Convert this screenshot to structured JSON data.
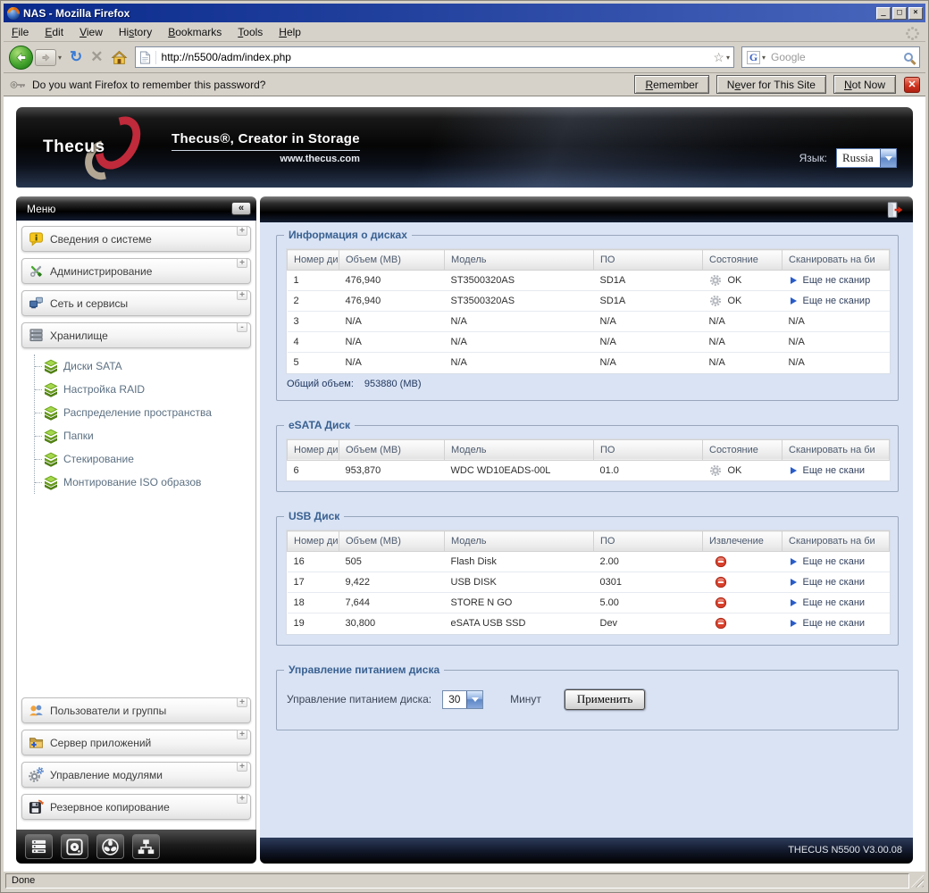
{
  "window": {
    "title": "NAS - Mozilla Firefox"
  },
  "menubar": {
    "items": [
      {
        "label": "File",
        "accel": 0
      },
      {
        "label": "Edit",
        "accel": 0
      },
      {
        "label": "View",
        "accel": 0
      },
      {
        "label": "History",
        "accel": 2
      },
      {
        "label": "Bookmarks",
        "accel": 0
      },
      {
        "label": "Tools",
        "accel": 0
      },
      {
        "label": "Help",
        "accel": 0
      }
    ]
  },
  "toolbar": {
    "url": "http://n5500/adm/index.php",
    "search_engine": "Google"
  },
  "notification": {
    "message": "Do you want Firefox to remember this password?",
    "buttons": [
      {
        "label": "Remember",
        "accel": 0
      },
      {
        "label": "Never for This Site",
        "accel": 1
      },
      {
        "label": "Not Now",
        "accel": 0
      }
    ]
  },
  "banner": {
    "brand": "Thecus",
    "tagline": "Thecus®, Creator in Storage",
    "website": "www.thecus.com",
    "language_label": "Язык:",
    "language_value": "Russia"
  },
  "sidebar": {
    "title": "Меню",
    "collapse_glyph": "«",
    "sections": [
      {
        "label": "Сведения о системе",
        "icon": "info-icon",
        "state": "+",
        "group": "top"
      },
      {
        "label": "Администрирование",
        "icon": "tools-icon",
        "state": "+",
        "group": "top"
      },
      {
        "label": "Сеть и сервисы",
        "icon": "network-icon",
        "state": "+",
        "group": "top"
      },
      {
        "label": "Хранилище",
        "icon": "storage-icon",
        "state": "-",
        "group": "top",
        "children": [
          "Диски SATA",
          "Настройка RAID",
          "Распределение пространства",
          "Папки",
          "Стекирование",
          "Монтирование ISO образов"
        ]
      },
      {
        "label": "Пользователи и группы",
        "icon": "users-icon",
        "state": "+",
        "group": "bottom"
      },
      {
        "label": "Сервер приложений",
        "icon": "app-server-icon",
        "state": "+",
        "group": "bottom"
      },
      {
        "label": "Управление модулями",
        "icon": "modules-icon",
        "state": "+",
        "group": "bottom"
      },
      {
        "label": "Резервное копирование",
        "icon": "backup-icon",
        "state": "+",
        "group": "bottom"
      }
    ],
    "footer_icons": [
      "server-status-icon",
      "disk-status-icon",
      "fan-status-icon",
      "network-status-icon"
    ]
  },
  "main": {
    "tables": [
      {
        "id": "disk-info",
        "legend": "Информация о дисках",
        "headers": [
          "Номер ди",
          "Объем (MB)",
          "Модель",
          "ПО",
          "Состояние",
          "Сканировать на би"
        ],
        "col_types": [
          "text",
          "text",
          "text",
          "text",
          "status",
          "scan"
        ],
        "rows": [
          [
            "1",
            "476,940",
            "ST3500320AS",
            "SD1A",
            "OK",
            "Еще не сканир"
          ],
          [
            "2",
            "476,940",
            "ST3500320AS",
            "SD1A",
            "OK",
            "Еще не сканир"
          ],
          [
            "3",
            "N/A",
            "N/A",
            "N/A",
            "N/A",
            "N/A"
          ],
          [
            "4",
            "N/A",
            "N/A",
            "N/A",
            "N/A",
            "N/A"
          ],
          [
            "5",
            "N/A",
            "N/A",
            "N/A",
            "N/A",
            "N/A"
          ]
        ],
        "footer_label": "Общий объем:",
        "footer_value": "953880 (MB)"
      },
      {
        "id": "esata",
        "legend": "eSATA Диск",
        "headers": [
          "Номер ди",
          "Объем (MB)",
          "Модель",
          "ПО",
          "Состояние",
          "Сканировать на би"
        ],
        "col_types": [
          "text",
          "text",
          "text",
          "text",
          "status",
          "scan"
        ],
        "rows": [
          [
            "6",
            "953,870",
            "WDC WD10EADS-00L",
            "01.0",
            "OK",
            "Еще не скани"
          ]
        ]
      },
      {
        "id": "usb",
        "legend": "USB Диск",
        "headers": [
          "Номер ди",
          "Объем (MB)",
          "Модель",
          "ПО",
          "Извлечение",
          "Сканировать на би"
        ],
        "col_types": [
          "text",
          "text",
          "text",
          "text",
          "eject",
          "scan"
        ],
        "rows": [
          [
            "16",
            "505",
            "Flash Disk",
            "2.00",
            "",
            "Еще не скани"
          ],
          [
            "17",
            "9,422",
            "USB DISK",
            "0301",
            "",
            "Еще не скани"
          ],
          [
            "18",
            "7,644",
            "STORE N GO",
            "5.00",
            "",
            "Еще не скани"
          ],
          [
            "19",
            "30,800",
            "eSATA USB SSD",
            "Dev",
            "",
            "Еще не скани"
          ]
        ]
      }
    ],
    "power": {
      "legend": "Управление питанием диска",
      "label": "Управление питанием диска:",
      "select_value": "30",
      "unit": "Минут",
      "apply_label": "Применить"
    },
    "footer_version": "THECUS N5500 V3.00.08"
  },
  "statusbar": {
    "text": "Done"
  },
  "colors": {
    "accent_blue": "#2a5cc8",
    "eject_red": "#d8402c",
    "legend_blue": "#3a6191",
    "content_bg": "#d9e3f4"
  }
}
